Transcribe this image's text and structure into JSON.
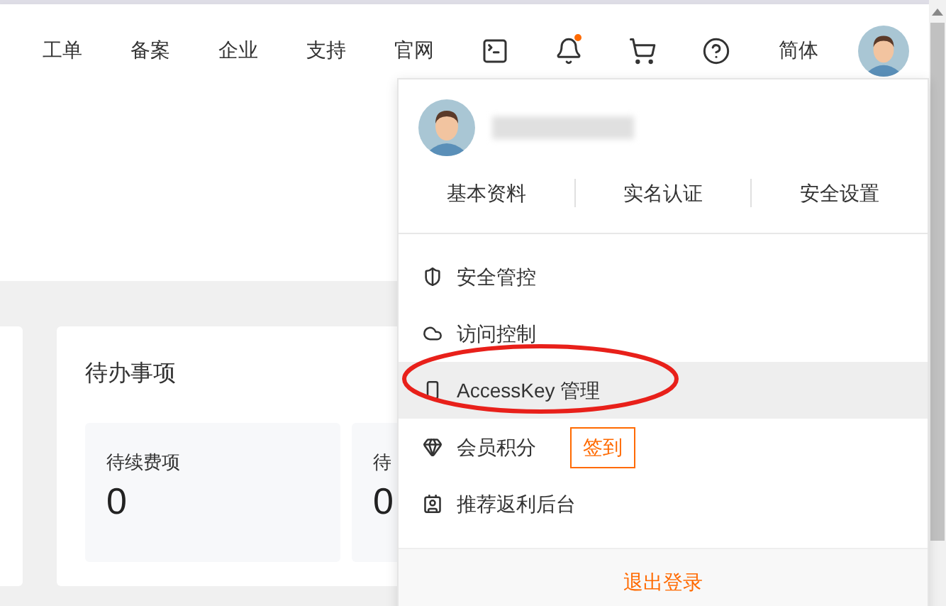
{
  "nav": {
    "links": [
      "工单",
      "备案",
      "企业",
      "支持",
      "官网"
    ],
    "has_notification": true,
    "language": "简体"
  },
  "profile_menu": {
    "tabs": [
      "基本资料",
      "实名认证",
      "安全设置"
    ],
    "items": [
      {
        "label": "安全管控",
        "selected": false
      },
      {
        "label": "访问控制",
        "selected": false
      },
      {
        "label": "AccessKey 管理",
        "selected": true
      },
      {
        "label": "会员积分",
        "selected": false,
        "action": "签到"
      },
      {
        "label": "推荐返利后台",
        "selected": false
      }
    ],
    "logout": "退出登录"
  },
  "todo_card": {
    "title": "待办事项",
    "tiles": [
      {
        "label": "待续费项",
        "value": "0"
      },
      {
        "label": "待",
        "value": "0"
      }
    ]
  }
}
